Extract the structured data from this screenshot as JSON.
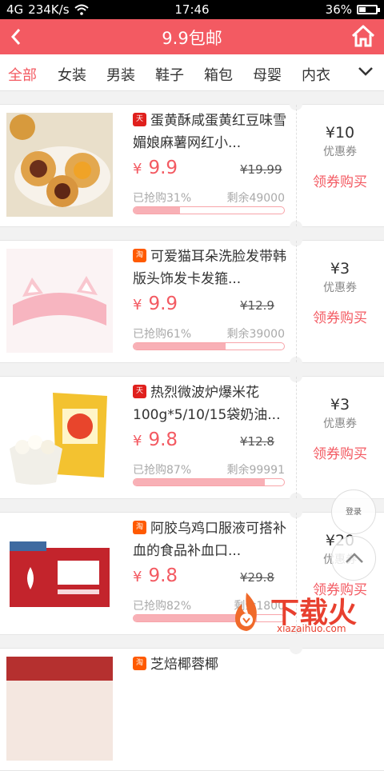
{
  "status": {
    "signal": "4G",
    "speed": "234K/s",
    "time": "17:46",
    "battery": "36%"
  },
  "header": {
    "title": "9.9包邮"
  },
  "tabs": [
    {
      "label": "全部",
      "active": true
    },
    {
      "label": "女装"
    },
    {
      "label": "男装"
    },
    {
      "label": "鞋子"
    },
    {
      "label": "箱包"
    },
    {
      "label": "母婴"
    },
    {
      "label": "内衣"
    }
  ],
  "items": [
    {
      "badge": "天猫",
      "name": "蛋黄酥咸蛋黄红豆味雪媚娘麻薯网红小...",
      "price": "9.9",
      "old": "¥19.99",
      "sold": "已抢购31%",
      "remain": "剩余49000",
      "progress": 0.31,
      "coupon": "¥10",
      "coupon_label": "优惠券",
      "btn": "领券购买"
    },
    {
      "badge": "淘",
      "name": "可爱猫耳朵洗脸发带韩版头饰发卡发箍...",
      "price": "9.9",
      "old": "¥12.9",
      "sold": "已抢购61%",
      "remain": "剩余39000",
      "progress": 0.61,
      "coupon": "¥3",
      "coupon_label": "优惠券",
      "btn": "领券购买"
    },
    {
      "badge": "天猫",
      "name": "热烈微波炉爆米花100g*5/10/15袋奶油...",
      "price": "9.8",
      "old": "¥12.8",
      "sold": "已抢购87%",
      "remain": "剩余99991",
      "progress": 0.87,
      "coupon": "¥3",
      "coupon_label": "优惠券",
      "btn": "领券购买"
    },
    {
      "badge": "淘",
      "name": "阿胶乌鸡口服液可搭补血的食品补血口...",
      "price": "9.8",
      "old": "¥29.8",
      "sold": "已抢购82%",
      "remain": "剩余1800",
      "progress": 0.82,
      "coupon": "¥20",
      "coupon_label": "优惠券",
      "btn": "领券购买"
    },
    {
      "badge": "淘",
      "name": "芝焙椰蓉椰",
      "price": "",
      "old": "",
      "sold": "",
      "remain": "",
      "progress": 0,
      "coupon": "",
      "coupon_label": "",
      "btn": ""
    }
  ],
  "float": {
    "login": "登录"
  },
  "watermark": {
    "text": "下载火",
    "url": "xiazaihuo.com"
  }
}
